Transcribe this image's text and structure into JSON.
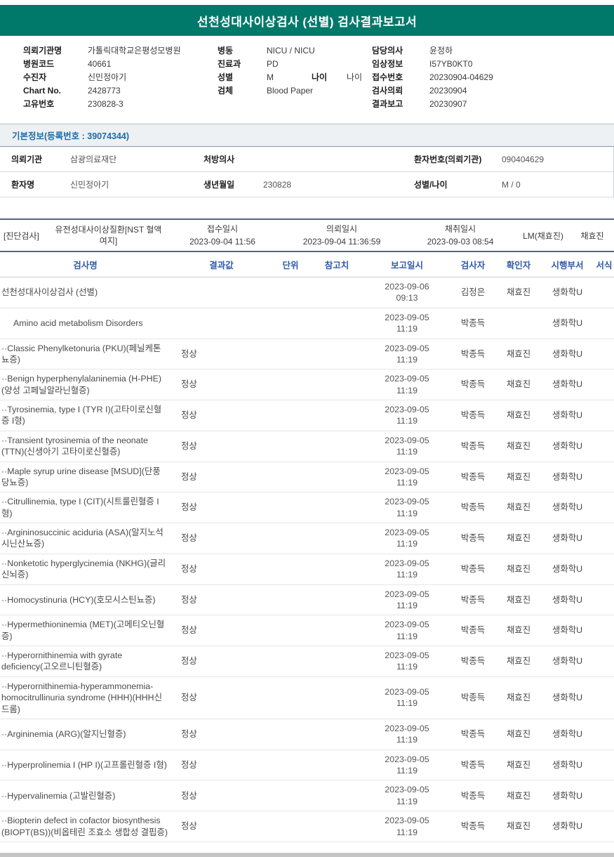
{
  "title": "선천성대사이상검사 (선별) 검사결과보고서",
  "colors": {
    "accent_teal": "#00796b",
    "table_header_blue": "#2f5ba8",
    "section_title_blue": "#1b6ca8",
    "footer_gray": "#c5c5c5"
  },
  "patient_info": {
    "columns": [
      {
        "rows": [
          [
            {
              "label": "의뢰기관명",
              "value": "가톨릭대학교은평성모병원"
            }
          ],
          [
            {
              "label": "병원코드",
              "value": "40661"
            }
          ],
          [
            {
              "label": "수진자",
              "value": "신민정아기"
            }
          ],
          [
            {
              "label": "Chart No.",
              "value": "2428773"
            }
          ],
          [
            {
              "label": "고유번호",
              "value": "230828-3"
            }
          ]
        ]
      },
      {
        "rows": [
          [
            {
              "label": "병동",
              "value": "NICU / NICU"
            }
          ],
          [
            {
              "label": "진료과",
              "value": "PD"
            }
          ],
          [
            {
              "label": "성별",
              "value": "M"
            },
            {
              "label": "나이",
              "value": "나이"
            }
          ],
          [
            {
              "label": "검체",
              "value": "Blood Paper"
            }
          ]
        ]
      },
      {
        "rows": [
          [
            {
              "label": "담당의사",
              "value": "윤정하"
            }
          ],
          [
            {
              "label": "임상정보",
              "value": "I57YB0KT0"
            }
          ],
          [
            {
              "label": "접수번호",
              "value": "20230904-04629"
            }
          ],
          [
            {
              "label": "검사의뢰",
              "value": "20230904"
            }
          ],
          [
            {
              "label": "결과보고",
              "value": "20230907"
            }
          ]
        ]
      }
    ]
  },
  "basic_info": {
    "title": "기본정보(등록번호 : 39074344)",
    "rows": [
      [
        {
          "label": "의뢰기관",
          "value": "삼광의료재단"
        },
        {
          "label": "처방의사",
          "value": ""
        },
        {
          "label": "환자번호(의뢰기관)",
          "value": "090404629"
        }
      ],
      [
        {
          "label": "환자명",
          "value": "신민정아기"
        },
        {
          "label": "생년월일",
          "value": "230828"
        },
        {
          "label": "성별/나이",
          "value": "M / 0"
        }
      ]
    ]
  },
  "exam_bar": {
    "category": "[진단검사]",
    "exam_name": "유전성대사이상질환[NST 혈액 여지]",
    "fields": [
      {
        "label": "접수일시",
        "value": "2023-09-04 11:56"
      },
      {
        "label": "의뢰일시",
        "value": "2023-09-04 11:36:59"
      },
      {
        "label": "채취일시",
        "value": "2023-09-03 08:54"
      }
    ],
    "lm": "LM(채효진)",
    "collector": "채효진"
  },
  "results_table": {
    "headers": [
      "검사명",
      "결과값",
      "단위",
      "참고치",
      "보고일시",
      "검사자",
      "확인자",
      "시행부서",
      "서식"
    ],
    "rows": [
      {
        "name": "선천성대사이상검사 (선별)",
        "result": "",
        "unit": "",
        "ref": "",
        "date": "2023-09-06",
        "time": "09:13",
        "examiner": "김정은",
        "confirmer": "채효진",
        "dept": "생화학U",
        "indent": 0
      },
      {
        "name": "Amino acid metabolism Disorders",
        "result": "",
        "unit": "",
        "ref": "",
        "date": "2023-09-05",
        "time": "11:19",
        "examiner": "박종득",
        "confirmer": "",
        "dept": "생화학U",
        "indent": 1
      },
      {
        "name": "··Classic Phenylketonuria (PKU)(페닐케톤뇨증)",
        "result": "정상",
        "unit": "",
        "ref": "",
        "date": "2023-09-05",
        "time": "11:19",
        "examiner": "박종득",
        "confirmer": "채효진",
        "dept": "생화학U",
        "indent": 0
      },
      {
        "name": "··Benign hyperphenylalaninemia (H-PHE)(양성 고페닐알라닌혈증)",
        "result": "정상",
        "unit": "",
        "ref": "",
        "date": "2023-09-05",
        "time": "11:19",
        "examiner": "박종득",
        "confirmer": "채효진",
        "dept": "생화학U",
        "indent": 0
      },
      {
        "name": "··Tyrosinemia, type I (TYR I)(고타이로신혈증 I형)",
        "result": "정상",
        "unit": "",
        "ref": "",
        "date": "2023-09-05",
        "time": "11:19",
        "examiner": "박종득",
        "confirmer": "채효진",
        "dept": "생화학U",
        "indent": 0
      },
      {
        "name": "··Transient tyrosinemia of the neonate (TTN)(신생아기 고타이로신혈증)",
        "result": "정상",
        "unit": "",
        "ref": "",
        "date": "2023-09-05",
        "time": "11:19",
        "examiner": "박종득",
        "confirmer": "채효진",
        "dept": "생화학U",
        "indent": 0
      },
      {
        "name": "··Maple syrup urine disease [MSUD](단풍당뇨증)",
        "result": "정상",
        "unit": "",
        "ref": "",
        "date": "2023-09-05",
        "time": "11:19",
        "examiner": "박종득",
        "confirmer": "채효진",
        "dept": "생화학U",
        "indent": 0
      },
      {
        "name": "··Citrullinemia, type I (CIT)(시트룰린혈증 I형)",
        "result": "정상",
        "unit": "",
        "ref": "",
        "date": "2023-09-05",
        "time": "11:19",
        "examiner": "박종득",
        "confirmer": "채효진",
        "dept": "생화학U",
        "indent": 0
      },
      {
        "name": "··Argininosuccinic aciduria (ASA)(알지노석시닌산뇨증)",
        "result": "정상",
        "unit": "",
        "ref": "",
        "date": "2023-09-05",
        "time": "11:19",
        "examiner": "박종득",
        "confirmer": "채효진",
        "dept": "생화학U",
        "indent": 0
      },
      {
        "name": "··Nonketotic hyperglycinemia (NKHG)(글리신뇌증)",
        "result": "정상",
        "unit": "",
        "ref": "",
        "date": "2023-09-05",
        "time": "11:19",
        "examiner": "박종득",
        "confirmer": "채효진",
        "dept": "생화학U",
        "indent": 0
      },
      {
        "name": "··Homocystinuria (HCY)(호모시스틴뇨증)",
        "result": "정상",
        "unit": "",
        "ref": "",
        "date": "2023-09-05",
        "time": "11:19",
        "examiner": "박종득",
        "confirmer": "채효진",
        "dept": "생화학U",
        "indent": 0
      },
      {
        "name": "··Hypermethioninemia (MET)(고메티오닌혈증)",
        "result": "정상",
        "unit": "",
        "ref": "",
        "date": "2023-09-05",
        "time": "11:19",
        "examiner": "박종득",
        "confirmer": "채효진",
        "dept": "생화학U",
        "indent": 0
      },
      {
        "name": "··Hyperornithinemia with gyrate deficiency(고오르니틴혈증)",
        "result": "정상",
        "unit": "",
        "ref": "",
        "date": "2023-09-05",
        "time": "11:19",
        "examiner": "박종득",
        "confirmer": "채효진",
        "dept": "생화학U",
        "indent": 0
      },
      {
        "name": "··Hyperornithinemia-hyperammonemia-homocitrullinuria syndrome (HHH)(HHH신드롬)",
        "result": "정상",
        "unit": "",
        "ref": "",
        "date": "2023-09-05",
        "time": "11:19",
        "examiner": "박종득",
        "confirmer": "채효진",
        "dept": "생화학U",
        "indent": 0
      },
      {
        "name": "··Argininemia (ARG)(알지닌혈증)",
        "result": "정상",
        "unit": "",
        "ref": "",
        "date": "2023-09-05",
        "time": "11:19",
        "examiner": "박종득",
        "confirmer": "채효진",
        "dept": "생화학U",
        "indent": 0
      },
      {
        "name": "··Hyperprolinemia I (HP I)(고프롤린혈증 I형)",
        "result": "정상",
        "unit": "",
        "ref": "",
        "date": "2023-09-05",
        "time": "11:19",
        "examiner": "박종득",
        "confirmer": "채효진",
        "dept": "생화학U",
        "indent": 0
      },
      {
        "name": "··Hypervalinemia (고발린혈증)",
        "result": "정상",
        "unit": "",
        "ref": "",
        "date": "2023-09-05",
        "time": "11:19",
        "examiner": "박종득",
        "confirmer": "채효진",
        "dept": "생화학U",
        "indent": 0
      },
      {
        "name": "··Biopterin defect in cofactor biosynthesis (BIOPT(BS))(비옵테린 조효소 생합성 결핍증)",
        "result": "정상",
        "unit": "",
        "ref": "",
        "date": "2023-09-05",
        "time": "11:19",
        "examiner": "박종득",
        "confirmer": "채효진",
        "dept": "생화학U",
        "indent": 0
      }
    ]
  }
}
